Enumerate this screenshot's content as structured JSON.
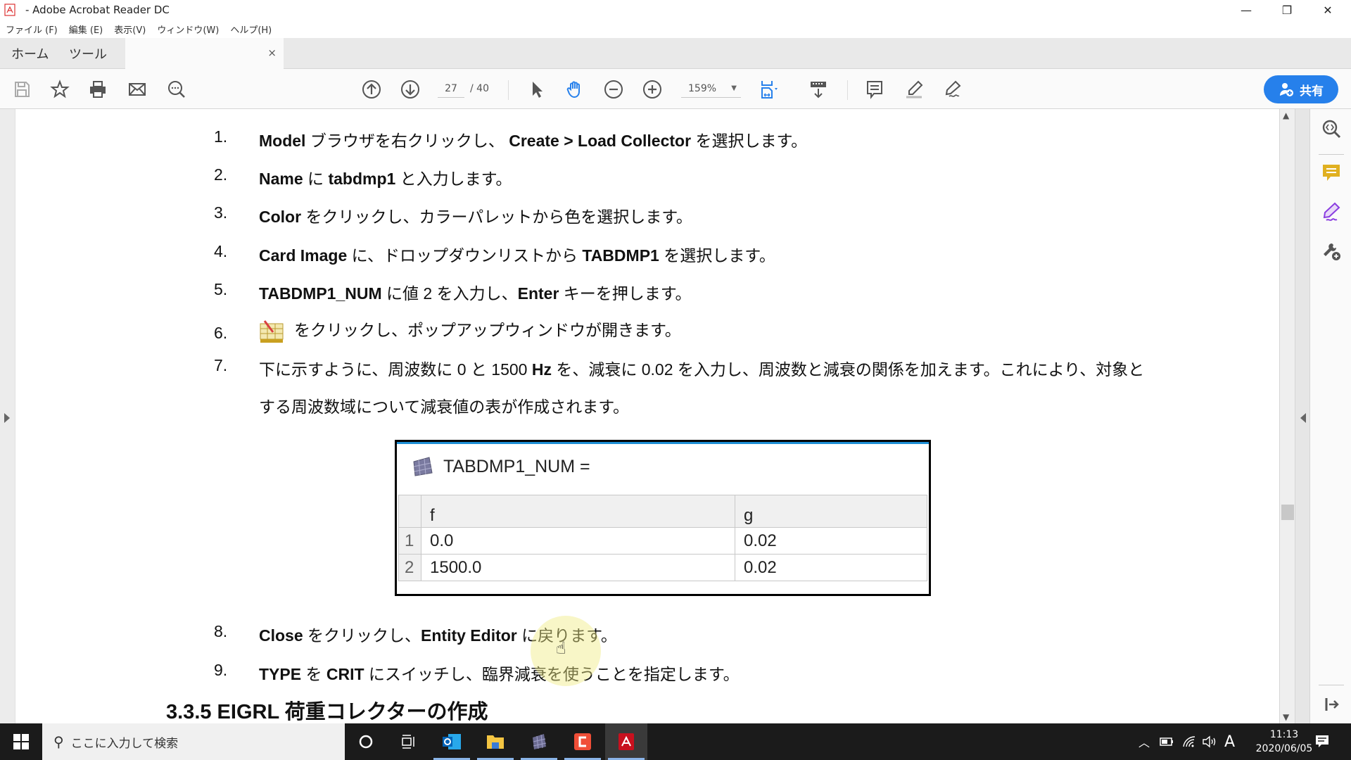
{
  "window": {
    "title": " - Adobe Acrobat Reader DC",
    "controls": {
      "minimize": "—",
      "restore": "❐",
      "close": "✕"
    }
  },
  "menu": [
    "ファイル (F)",
    "編集 (E)",
    "表示(V)",
    "ウィンドウ(W)",
    "ヘルプ(H)"
  ],
  "tabs": {
    "home": "ホーム",
    "tools": "ツール",
    "doc_close": "×"
  },
  "toolbar": {
    "page_current": "27",
    "page_total": "/ 40",
    "zoom_level": "159%",
    "share_label": "共有",
    "accent_color": "#2680eb"
  },
  "document": {
    "steps": [
      {
        "num": "1.",
        "parts": [
          [
            "b",
            "Model"
          ],
          [
            "t",
            " ブラウザを右クリックし、 "
          ],
          [
            "b",
            "Create > Load Collector"
          ],
          [
            "t",
            " を選択します。"
          ]
        ]
      },
      {
        "num": "2.",
        "parts": [
          [
            "b",
            "Name"
          ],
          [
            "t",
            " に "
          ],
          [
            "b",
            "tabdmp1"
          ],
          [
            "t",
            " と入力します。"
          ]
        ]
      },
      {
        "num": "3.",
        "parts": [
          [
            "b",
            "Color"
          ],
          [
            "t",
            " をクリックし、カラーパレットから色を選択します。"
          ]
        ]
      },
      {
        "num": "4.",
        "parts": [
          [
            "b",
            "Card Image"
          ],
          [
            "t",
            " に、ドロップダウンリストから "
          ],
          [
            "b",
            "TABDMP1"
          ],
          [
            "t",
            " を選択します。"
          ]
        ]
      },
      {
        "num": "5.",
        "parts": [
          [
            "b",
            "TABDMP1_NUM"
          ],
          [
            "t",
            " に値 2 を入力し、"
          ],
          [
            "b",
            "Enter"
          ],
          [
            "t",
            " キーを押します。"
          ]
        ]
      },
      {
        "num": "6.",
        "parts": [
          [
            "t",
            "をクリックし、ポップアップウィンドウが開きます。"
          ]
        ]
      },
      {
        "num": "7.",
        "parts": [
          [
            "t",
            "下に示すように、周波数に 0 と 1500 "
          ],
          [
            "b",
            "Hz"
          ],
          [
            "t",
            " を、減衰に 0.02 を入力し、周波数と減衰の関係を加えます。これにより、対象と"
          ]
        ]
      },
      {
        "num": "",
        "parts": [
          [
            "t",
            "する周波数域について減衰値の表が作成されます。"
          ]
        ]
      },
      {
        "num": "8.",
        "parts": [
          [
            "b",
            "Close"
          ],
          [
            "t",
            " をクリックし、"
          ],
          [
            "b",
            "Entity Editor"
          ],
          [
            "t",
            " に戻ります。"
          ]
        ]
      },
      {
        "num": "9.",
        "parts": [
          [
            "b",
            "TYPE"
          ],
          [
            "t",
            " を "
          ],
          [
            "b",
            "CRIT"
          ],
          [
            "t",
            " にスイッチし、臨界減衰を使うことを指定します。"
          ]
        ]
      }
    ],
    "table": {
      "title": "TABDMP1_NUM =",
      "columns": [
        "f",
        "g"
      ],
      "rows": [
        {
          "index": "1",
          "f": "0.0",
          "g": "0.02"
        },
        {
          "index": "2",
          "f": "1500.0",
          "g": "0.02"
        }
      ]
    },
    "section_heading": "3.3.5  EIGRL  荷重コレクターの作成"
  },
  "taskbar": {
    "search_placeholder": "ここに入力して検索",
    "ime_indicator": "A",
    "time": "11:13",
    "date": "2020/06/05"
  }
}
